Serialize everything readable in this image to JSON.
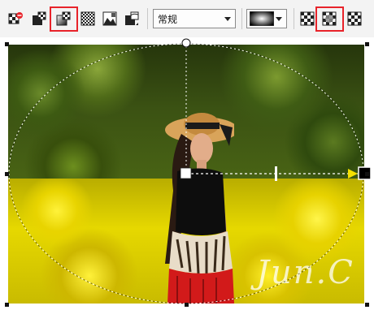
{
  "toolbar": {
    "blend_mode_value": "常规"
  },
  "colors": {
    "highlight": "#e8232a",
    "toolbar_bg": "#f3f3f3",
    "fill_end_color": "#000000",
    "fill_start_color": "#ffffff"
  },
  "icons": [
    "remove-transparency-icon",
    "uniform-transparency-icon",
    "fountain-transparency-icon",
    "pattern-transparency-icon",
    "bitmap-pattern-transparency-icon",
    "texture-transparency-icon",
    "fountain-preset-swatch",
    "linear-fountain-icon",
    "elliptical-fountain-icon",
    "conical-fountain-icon"
  ],
  "canvas": {
    "watermark_text": "Jun.C"
  }
}
